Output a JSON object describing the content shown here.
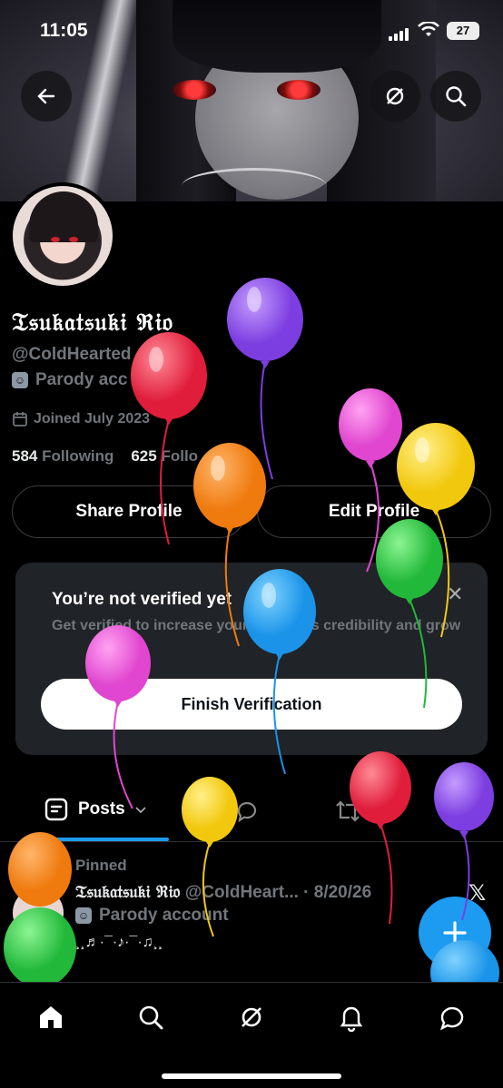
{
  "status_bar": {
    "time": "11:05",
    "battery": "27"
  },
  "profile": {
    "name": "𝔗𝔰𝔲𝔨𝔞𝔱𝔰𝔲𝔨𝔦 ℜ𝔦𝔬",
    "handle": "@ColdHearted",
    "parody": "Parody acc",
    "joined": "Joined July 2023",
    "following_count": "584",
    "following_label": "Following",
    "followers_count": "625",
    "followers_label": "Follo"
  },
  "buttons": {
    "share": "Share Profile",
    "edit": "Edit Profile"
  },
  "verify": {
    "title": "You’re not verified yet",
    "desc": "Get verified to increase your account’s credibility and grow",
    "button": "Finish Verification"
  },
  "tabs": {
    "posts": "Posts"
  },
  "post": {
    "pinned": "Pinned",
    "author_name": "𝔗𝔰𝔲𝔨𝔞𝔱𝔰𝔲𝔨𝔦 ℜ𝔦𝔬",
    "author_meta": "@ColdHeart... · 8/20/26",
    "parody": "Parody account",
    "text": "¸¸♬·¯·♪·¯·♫¸¸"
  },
  "icons": {
    "back": "back-arrow-icon",
    "grok": "grok-icon",
    "search": "search-icon",
    "home": "home-icon",
    "explore": "search-icon",
    "grok_nav": "grok-icon",
    "notifications": "bell-icon",
    "messages": "chat-icon",
    "compose": "plus-icon"
  },
  "colors": {
    "accent": "#1d9bf0",
    "card": "#202327",
    "muted": "#71767b"
  }
}
